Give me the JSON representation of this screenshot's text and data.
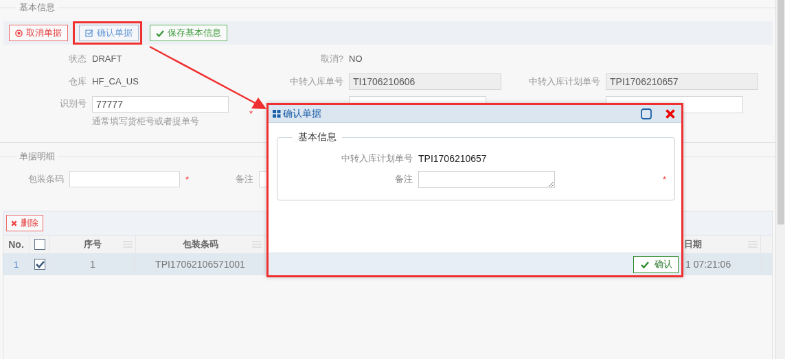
{
  "basic_info": {
    "legend": "基本信息",
    "buttons": [
      {
        "kind": "cancel",
        "label": "取消单据",
        "highlighted": false
      },
      {
        "kind": "confirm",
        "label": "确认单据",
        "highlighted": true
      },
      {
        "kind": "save",
        "label": "保存基本信息",
        "highlighted": false
      }
    ],
    "status": {
      "label": "状态",
      "value": "DRAFT"
    },
    "cancelled": {
      "label": "取消?",
      "value": "NO"
    },
    "warehouse": {
      "label": "仓库",
      "value": "HF_CA_US"
    },
    "transfer_no": {
      "label": "中转入库单号",
      "value": "TI1706210606"
    },
    "plan_no": {
      "label": "中转入库计划单号",
      "value": "TPI1706210657"
    },
    "id_no": {
      "label": "识别号",
      "value": "77777",
      "required_mark": "*",
      "hint": "通常填写货柜号或者提单号"
    }
  },
  "details": {
    "legend": "单据明细",
    "barcode": {
      "label": "包装条码",
      "required_mark": "*"
    },
    "remark": {
      "label": "备注"
    },
    "delete_button": "删除",
    "table": {
      "columns": [
        "No.",
        "序号",
        "包装条码",
        "日期"
      ],
      "header_checked": false,
      "rows": [
        {
          "no": "1",
          "checked": true,
          "selected": true,
          "seq": "1",
          "barcode": "TPI17062106571001",
          "column_5": "1 07:21:06"
        }
      ]
    }
  },
  "dialog": {
    "title": "确认单据",
    "legend": "基本信息",
    "plan_no": {
      "label": "中转入库计划单号",
      "value": "TPI1706210657"
    },
    "remark": {
      "label": "备注",
      "required_mark": "*"
    },
    "confirm_button": "确认"
  }
}
